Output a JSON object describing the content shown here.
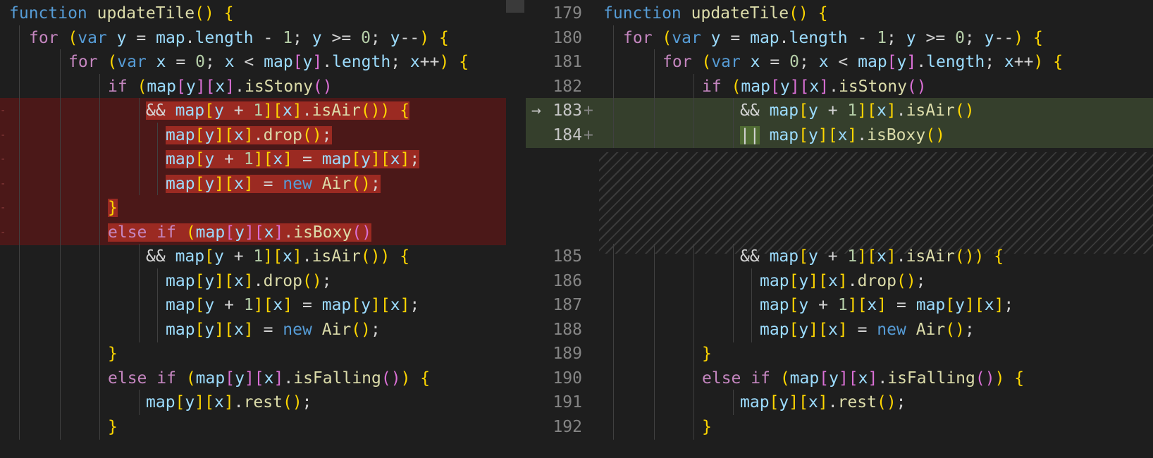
{
  "left": {
    "lines": [
      {
        "type": "normal",
        "indent": 0,
        "text": "function updateTile() {"
      },
      {
        "type": "normal",
        "indent": 1,
        "text": "for (var y = map.length - 1; y >= 0; y--) {"
      },
      {
        "type": "normal",
        "indent": 2,
        "text": "for (var x = 0; x < map[y].length; x++) {"
      },
      {
        "type": "normal",
        "indent": 3,
        "text": "if (map[y][x].isStony()"
      },
      {
        "type": "removed",
        "indent": 4,
        "text": "&& map[y + 1][x].isAir()) {"
      },
      {
        "type": "removed",
        "indent": 5,
        "text": "map[y][x].drop();"
      },
      {
        "type": "removed",
        "indent": 5,
        "text": "map[y + 1][x] = map[y][x];"
      },
      {
        "type": "removed",
        "indent": 5,
        "text": "map[y][x] = new Air();"
      },
      {
        "type": "removed",
        "indent": 3,
        "text": "}"
      },
      {
        "type": "removed",
        "indent": 3,
        "text": "else if (map[y][x].isBoxy()"
      },
      {
        "type": "normal",
        "indent": 4,
        "text": "&& map[y + 1][x].isAir()) {"
      },
      {
        "type": "normal",
        "indent": 5,
        "text": "map[y][x].drop();"
      },
      {
        "type": "normal",
        "indent": 5,
        "text": "map[y + 1][x] = map[y][x];"
      },
      {
        "type": "normal",
        "indent": 5,
        "text": "map[y][x] = new Air();"
      },
      {
        "type": "normal",
        "indent": 3,
        "text": "}"
      },
      {
        "type": "normal",
        "indent": 3,
        "text": "else if (map[y][x].isFalling()) {"
      },
      {
        "type": "normal",
        "indent": 4,
        "text": "map[y][x].rest();"
      },
      {
        "type": "normal",
        "indent": 3,
        "text": "}"
      }
    ]
  },
  "right": {
    "lines": [
      {
        "num": "179",
        "type": "normal",
        "indent": 0,
        "text": "function updateTile() {"
      },
      {
        "num": "180",
        "type": "normal",
        "indent": 1,
        "text": "for (var y = map.length - 1; y >= 0; y--) {"
      },
      {
        "num": "181",
        "type": "normal",
        "indent": 2,
        "text": "for (var x = 0; x < map[y].length; x++) {"
      },
      {
        "num": "182",
        "type": "normal",
        "indent": 3,
        "text": "if (map[y][x].isStony()"
      },
      {
        "num": "183",
        "type": "added",
        "marker": "+",
        "arrow": "→",
        "indent": 4,
        "text": "&& map[y + 1][x].isAir()"
      },
      {
        "num": "184",
        "type": "added",
        "marker": "+",
        "indent": 4,
        "text": "|| map[y][x].isBoxy()"
      },
      {
        "num": "",
        "type": "filler",
        "indent": 0,
        "text": ""
      },
      {
        "num": "",
        "type": "filler",
        "indent": 0,
        "text": ""
      },
      {
        "num": "",
        "type": "filler",
        "indent": 0,
        "text": ""
      },
      {
        "num": "",
        "type": "filler",
        "indent": 0,
        "text": ""
      },
      {
        "num": "185",
        "type": "normal",
        "indent": 4,
        "text": "&& map[y + 1][x].isAir()) {"
      },
      {
        "num": "186",
        "type": "normal",
        "indent": 5,
        "text": "map[y][x].drop();"
      },
      {
        "num": "187",
        "type": "normal",
        "indent": 5,
        "text": "map[y + 1][x] = map[y][x];"
      },
      {
        "num": "188",
        "type": "normal",
        "indent": 5,
        "text": "map[y][x] = new Air();"
      },
      {
        "num": "189",
        "type": "normal",
        "indent": 3,
        "text": "}"
      },
      {
        "num": "190",
        "type": "normal",
        "indent": 3,
        "text": "else if (map[y][x].isFalling()) {"
      },
      {
        "num": "191",
        "type": "normal",
        "indent": 4,
        "text": "map[y][x].rest();"
      },
      {
        "num": "192",
        "type": "normal",
        "indent": 3,
        "text": "}"
      }
    ]
  },
  "colors": {
    "removed_line_bg": "#4b1818",
    "removed_token_bg": "#9b2a22",
    "added_line_bg": "#353f2c",
    "added_token_bg": "#4f6a33",
    "editor_bg": "#1e1e1e"
  }
}
